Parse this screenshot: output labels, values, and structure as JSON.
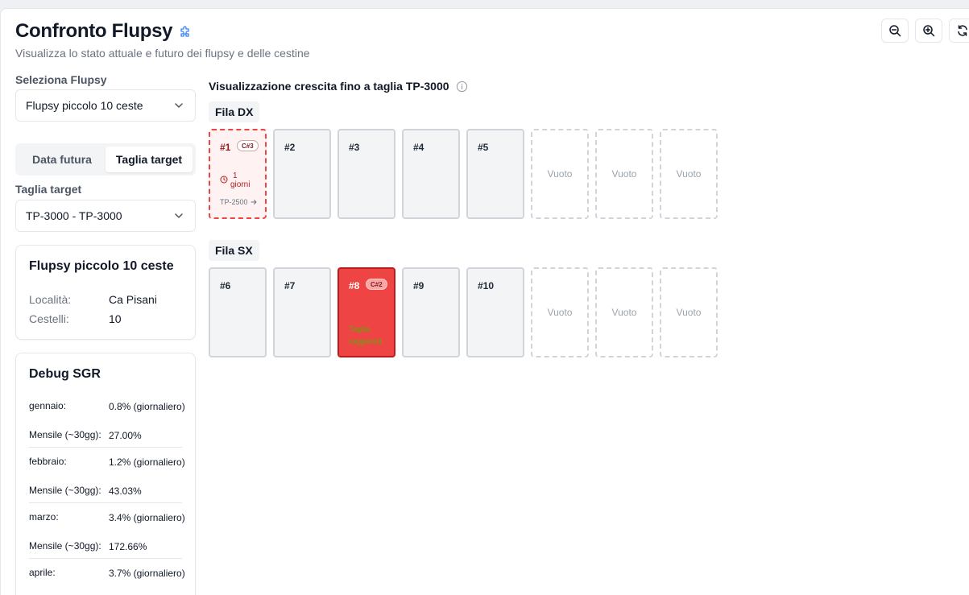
{
  "header": {
    "title": "Confronto Flupsy",
    "subtitle": "Visualizza lo stato attuale e futuro dei flupsy e delle cestine"
  },
  "toolbar": {
    "zoom_out_icon": "zoom-out-icon",
    "zoom_in_icon": "zoom-in-icon",
    "refresh_icon": "refresh-icon"
  },
  "sidebar": {
    "flupsy_label": "Seleziona Flupsy",
    "flupsy_selected": "Flupsy piccolo 10 ceste",
    "tabs": [
      {
        "label": "Data futura",
        "active": false
      },
      {
        "label": "Taglia target",
        "active": true
      }
    ],
    "target_label": "Taglia target",
    "target_selected": "TP-3000 - TP-3000"
  },
  "info_card": {
    "title": "Flupsy piccolo 10 ceste",
    "rows": [
      {
        "key": "Località:",
        "value": "Ca Pisani"
      },
      {
        "key": "Cestelli:",
        "value": "10"
      }
    ]
  },
  "debug_card": {
    "title": "Debug SGR",
    "months": [
      {
        "name": "gennaio:",
        "daily": "0.8% (giornaliero)",
        "monthly_label": "Mensile (~30gg):",
        "monthly": "27.00%"
      },
      {
        "name": "febbraio:",
        "daily": "1.2% (giornaliero)",
        "monthly_label": "Mensile (~30gg):",
        "monthly": "43.03%"
      },
      {
        "name": "marzo:",
        "daily": "3.4% (giornaliero)",
        "monthly_label": "Mensile (~30gg):",
        "monthly": "172.66%"
      },
      {
        "name": "aprile:",
        "daily": "3.7% (giornaliero)"
      }
    ]
  },
  "main": {
    "title": "Visualizzazione crescita fino a taglia TP-3000",
    "info_icon": "info-icon",
    "rows": [
      {
        "label": "Fila DX",
        "baskets": [
          {
            "kind": "warn",
            "num": "#1",
            "badge": "C#3",
            "days_num": "1",
            "days_unit": "giorni",
            "size": "TP-2500"
          },
          {
            "kind": "normal",
            "num": "#2"
          },
          {
            "kind": "normal",
            "num": "#3"
          },
          {
            "kind": "normal",
            "num": "#4"
          },
          {
            "kind": "normal",
            "num": "#5"
          },
          {
            "kind": "empty",
            "label": "Vuoto"
          },
          {
            "kind": "empty",
            "label": "Vuoto"
          },
          {
            "kind": "empty",
            "label": "Vuoto"
          }
        ]
      },
      {
        "label": "Fila SX",
        "baskets": [
          {
            "kind": "normal",
            "num": "#6"
          },
          {
            "kind": "normal",
            "num": "#7"
          },
          {
            "kind": "red",
            "num": "#8",
            "badge": "C#2",
            "status": "Taglia raggiunta"
          },
          {
            "kind": "normal",
            "num": "#9"
          },
          {
            "kind": "normal",
            "num": "#10"
          },
          {
            "kind": "empty",
            "label": "Vuoto"
          },
          {
            "kind": "empty",
            "label": "Vuoto"
          },
          {
            "kind": "empty",
            "label": "Vuoto"
          }
        ]
      }
    ]
  }
}
